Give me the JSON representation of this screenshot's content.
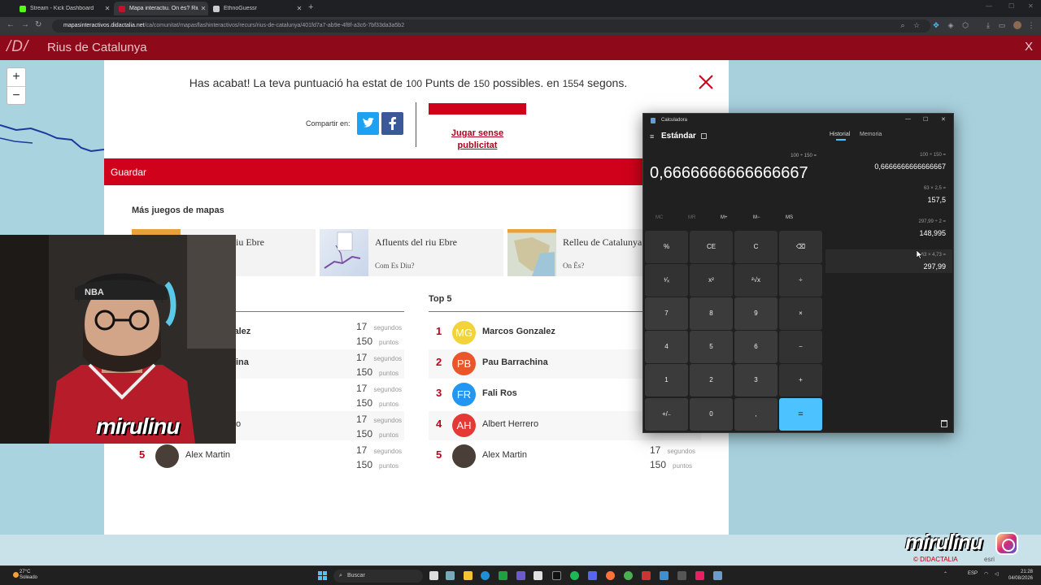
{
  "browser": {
    "tabs": [
      {
        "title": "Stream - Kick Dashboard",
        "favicon_color": "#53fc18"
      },
      {
        "title": "Mapa interactiu. On és? Rius de",
        "favicon_color": "#c8102e"
      },
      {
        "title": "EthnoGuessr",
        "favicon_color": "#cccccc"
      }
    ],
    "url_host": "mapasinteractivos.didactalia.net",
    "url_path": "/ca/comunitat/mapasflashinteractivos/recurs/rius-de-catalunya/401fd7a7-ab9e-4f8f-a3c6-7bf33da3a5b2"
  },
  "site": {
    "logo": "/D/",
    "title": "Rius de Catalunya",
    "close_label": "X",
    "zoom_in": "+",
    "zoom_out": "−"
  },
  "results": {
    "pre": "Has acabat! La teva puntuació ha estat de",
    "score": "100",
    "mid": "Punts de",
    "total": "150",
    "post": "possibles. en",
    "time": "1554",
    "unit": "segons.",
    "share_label": "Compartir en:",
    "adfree_line1": "Jugar sense",
    "adfree_line2": "publicitat",
    "save_label": "Guardar",
    "more_games_title": "Más juegos de mapas"
  },
  "more_games": [
    {
      "title": "Afluents del riu Ebre",
      "subtitle": "Com Es Diu?"
    },
    {
      "title": "Relleu de Catalunya",
      "subtitle": "On Ës?"
    }
  ],
  "card_partial_title": "iu Ebre",
  "top5_title": "Top 5",
  "left_rows": [
    {
      "name": "zalez",
      "time": "17",
      "score": "150"
    },
    {
      "name": "ina",
      "time": "17",
      "score": "150"
    },
    {
      "name": "",
      "time": "17",
      "score": "150"
    },
    {
      "name": "o",
      "time": "17",
      "score": "150"
    },
    {
      "rank": "5",
      "name": "Alex Martin",
      "time": "17",
      "score": "150"
    }
  ],
  "top5": [
    {
      "rank": "1",
      "initials": "MG",
      "color": "#f2d33a",
      "name": "Marcos Gonzalez"
    },
    {
      "rank": "2",
      "initials": "PB",
      "color": "#e8562a",
      "name": "Pau Barrachina"
    },
    {
      "rank": "3",
      "initials": "FR",
      "color": "#2196f3",
      "name": "Fali Ros"
    },
    {
      "rank": "4",
      "initials": "AH",
      "color": "#e53935",
      "name": "Albert Herrero"
    },
    {
      "rank": "5",
      "initials": "",
      "color": "#555555",
      "name": "Alex Martin",
      "time": "17",
      "score": "150"
    }
  ],
  "units": {
    "time": "segundos",
    "score": "puntos"
  },
  "calculator": {
    "title": "Calculadora",
    "mode": "Estándar",
    "expression": "100 ÷ 150 =",
    "display": "0,6666666666666667",
    "memory": [
      "MC",
      "MR",
      "M+",
      "M−",
      "MS"
    ],
    "keys": [
      "%",
      "CE",
      "C",
      "⌫",
      "¹⁄ₓ",
      "x²",
      "²√x",
      "÷",
      "7",
      "8",
      "9",
      "×",
      "4",
      "5",
      "6",
      "−",
      "1",
      "2",
      "3",
      "+",
      "+/₋",
      "0",
      ",",
      "="
    ],
    "history_tab": "Historial",
    "memory_tab": "Memoria",
    "history": [
      {
        "expr": "100  ÷  150 =",
        "result": "0,6666666666666667"
      },
      {
        "expr": "63  ×  2,5 =",
        "result": "157,5"
      },
      {
        "expr": "297,99  ÷  2 =",
        "result": "148,995"
      },
      {
        "expr": "63  ×  4,73 =",
        "result": "297,99"
      }
    ]
  },
  "overlay": {
    "cam_name": "mirulinu",
    "brand_name": "mirulinu",
    "credit_left": "© DIDACTALIA",
    "credit_right": "esri"
  },
  "taskbar": {
    "temp": "27°C",
    "weather": "Soleado",
    "search": "Buscar",
    "lang": "ESP",
    "time": "21:28",
    "date": "04/08/2026"
  }
}
